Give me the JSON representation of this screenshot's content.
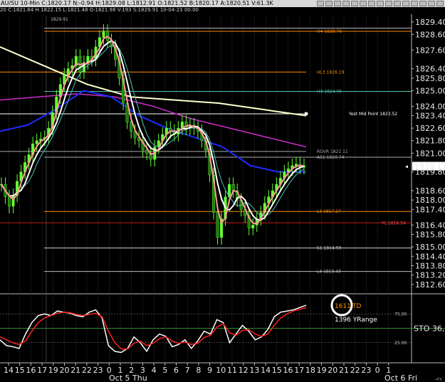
{
  "window": {
    "title": "AU/SU 10-Min  C:1820.17  N:-0.94  H:1829.08  L:1812.91  O:1821.52  B:1820.17  A:1820.51  V:61.3K",
    "subtitle": "20  C:1821.64  H:1822.15  L:1821.48  O:1821.98  V:193  S:1829.91  10-04-23  00:00",
    "buttons": [
      "minimize-icon",
      "restore-icon",
      "close-icon",
      "menu-icon",
      "list-icon",
      "tools-icon",
      "grid-icon",
      "pointer-icon",
      "crosshair-icon",
      "zoom-icon",
      "print-icon",
      "pin-icon",
      "link-icon",
      "settings-icon",
      "help-icon"
    ]
  },
  "colors": {
    "background": "#000000",
    "candle_up": "#66ff33",
    "price_line": "#ff9999",
    "white_line": "#ffffff",
    "ema_long": "#ffffcc",
    "blue_line": "#1e2bff",
    "magenta_line": "#cc2ccc",
    "teal_line": "#4ec3b2",
    "stoch_red": "#ff2020",
    "stoch_white": "#ffffff",
    "accent_orange": "#ff8c00"
  },
  "chart_data": [
    {
      "type": "candlestick",
      "series_name": "AU/SU 10-Min",
      "ylim": [
        1812.0,
        1829.8
      ],
      "yticks": [
        "1829.40",
        "1828.60",
        "1827.60",
        "1826.40",
        "1825.80",
        "1825.00",
        "1824.00",
        "1823.40",
        "1822.60",
        "1821.80",
        "1821.00",
        "1820.17",
        "1819.80",
        "1818.60",
        "1818.00",
        "1817.40",
        "1816.40",
        "1815.80",
        "1815.00",
        "1814.40",
        "1813.80",
        "1813.20",
        "1812.60"
      ],
      "yticks_values": [
        1829.4,
        1828.6,
        1827.6,
        1826.4,
        1825.8,
        1825.0,
        1824.0,
        1823.4,
        1822.6,
        1821.8,
        1821.0,
        1820.17,
        1819.8,
        1818.6,
        1818.0,
        1817.4,
        1816.4,
        1815.8,
        1815.0,
        1814.4,
        1813.8,
        1813.2,
        1812.6
      ],
      "current_price": "1820.17",
      "top_label": "1829.91",
      "close": [
        1819.0,
        1818.2,
        1817.6,
        1818.3,
        1819.2,
        1819.8,
        1820.4,
        1820.9,
        1821.6,
        1821.8,
        1821.9,
        1822.0,
        1822.6,
        1823.6,
        1824.6,
        1825.4,
        1826.0,
        1826.4,
        1826.6,
        1827.2,
        1826.2,
        1826.8,
        1827.2,
        1827.0,
        1827.8,
        1828.4,
        1828.8,
        1828.2,
        1827.8,
        1827.0,
        1825.8,
        1824.2,
        1823.0,
        1822.4,
        1822.0,
        1821.8,
        1821.2,
        1821.0,
        1820.6,
        1821.4,
        1821.8,
        1822.2,
        1822.6,
        1822.4,
        1822.2,
        1822.6,
        1823.0,
        1822.6,
        1822.8,
        1822.6,
        1822.4,
        1821.8,
        1821.2,
        1819.6,
        1817.2,
        1815.6,
        1816.8,
        1818.2,
        1819.0,
        1818.6,
        1818.0,
        1817.4,
        1817.0,
        1816.2,
        1816.4,
        1816.8,
        1817.2,
        1817.8,
        1818.2,
        1818.6,
        1819.0,
        1819.4,
        1819.8,
        1820.0,
        1820.2,
        1820.3,
        1820.1,
        1820.2
      ],
      "overlays": [
        {
          "name": "yellow-long-ema",
          "values": [
            1827.8,
            1826.6,
            1825.4,
            1824.6,
            1824.4,
            1824.2,
            1823.8,
            1823.4
          ]
        },
        {
          "name": "magenta-ma",
          "values": [
            1824.4,
            1824.6,
            1824.8,
            1824.6,
            1824.0,
            1823.2,
            1822.6,
            1822.0,
            1821.4
          ]
        },
        {
          "name": "blue-ma",
          "values": [
            1822.4,
            1822.8,
            1823.8,
            1825.0,
            1824.6,
            1823.4,
            1822.6,
            1822.0,
            1821.4,
            1820.2,
            1819.8,
            1819.8
          ]
        }
      ],
      "levels": [
        {
          "label": "1829.91",
          "price": 1829.0,
          "color": "#bbbbbb"
        },
        {
          "label": "H4 1828.76",
          "price": 1828.8,
          "color": "#ff8c00"
        },
        {
          "label": "HL3 1826.19",
          "price": 1826.19,
          "color": "#ff8c00"
        },
        {
          "label": "H3 1824.95",
          "price": 1824.95,
          "color": "#4ec3b2"
        },
        {
          "label": "Yest Mid Point 1823.52",
          "price": 1823.52,
          "color": "#ffffff"
        },
        {
          "label": "ROVR 1821.11",
          "price": 1821.11,
          "color": "#aaaaaa"
        },
        {
          "label": "AS1 1820.74",
          "price": 1820.74,
          "color": "#aaaaaa"
        },
        {
          "label": "L3 1817.27",
          "price": 1817.27,
          "color": "#ff8c00"
        },
        {
          "label": "YL 1816.54",
          "price": 1816.54,
          "color": "#c01818"
        },
        {
          "label": "S1 1814.93",
          "price": 1814.93,
          "color": "#cccccc"
        },
        {
          "label": "L4 1813.43",
          "price": 1813.43,
          "color": "#bbbbbb"
        }
      ]
    },
    {
      "type": "line",
      "name": "STO",
      "label": "STO  36,",
      "ylim": [
        0,
        100
      ],
      "yticks": [
        "75.00",
        "25.00"
      ],
      "yticks_values": [
        75,
        25
      ],
      "series": [
        {
          "name": "fast",
          "color": "#ffffff",
          "values": [
            30,
            20,
            18,
            15,
            40,
            60,
            72,
            75,
            72,
            80,
            78,
            76,
            72,
            70,
            78,
            82,
            68,
            20,
            10,
            8,
            15,
            35,
            25,
            10,
            30,
            40,
            36,
            18,
            22,
            30,
            15,
            28,
            45,
            40,
            65,
            60,
            25,
            40,
            55,
            45,
            30,
            35,
            48,
            70,
            78,
            80,
            82,
            86,
            90
          ]
        },
        {
          "name": "slow",
          "color": "#ff2020",
          "values": [
            35,
            30,
            25,
            22,
            28,
            45,
            60,
            68,
            72,
            76,
            78,
            77,
            74,
            72,
            74,
            76,
            70,
            45,
            25,
            14,
            14,
            24,
            28,
            20,
            24,
            32,
            35,
            28,
            24,
            26,
            22,
            24,
            34,
            38,
            52,
            58,
            42,
            38,
            46,
            48,
            40,
            36,
            40,
            55,
            68,
            75,
            80,
            83,
            86
          ]
        }
      ]
    }
  ],
  "xaxis": {
    "ticks": [
      "14",
      "15",
      "16",
      "17",
      "19",
      "20",
      "21",
      "22",
      "23",
      "0",
      "1",
      "2",
      "3",
      "4",
      "5",
      "6",
      "7",
      "8",
      "9",
      "10",
      "11",
      "12",
      "13",
      "14",
      "15",
      "16",
      "17",
      "18",
      "19",
      "20",
      "21",
      "22",
      "23",
      "0",
      "1"
    ],
    "date_labels": [
      "Oct 5 Thu",
      "Oct 6 Fri"
    ],
    "corner_label": "→FX"
  },
  "annotations": {
    "circle_value": "1611",
    "circle_suffix": "TD",
    "range_text": "1396 YRange",
    "markers": [
      "◂",
      "◂",
      "◂"
    ]
  }
}
